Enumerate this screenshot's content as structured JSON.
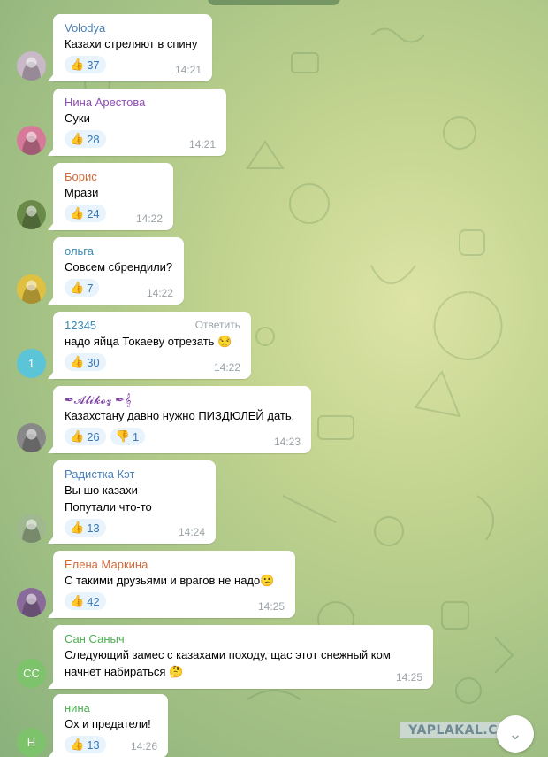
{
  "colors": {
    "reaction_bg": "#e8f3fb",
    "reaction_text": "#3a78b5",
    "time": "#9aa3a7"
  },
  "messages": [
    {
      "name": "Volodya",
      "name_color": "#4a7fb5",
      "text": [
        "Казахи стреляют в спину"
      ],
      "reactions": [
        {
          "emoji": "👍",
          "count": "37"
        }
      ],
      "time": "14:21",
      "avatar": {
        "type": "photo",
        "bg": "#c9b8c8"
      }
    },
    {
      "name": "Нина Арестова",
      "name_color": "#8e4bb5",
      "text": [
        "Суки"
      ],
      "reactions": [
        {
          "emoji": "👍",
          "count": "28"
        }
      ],
      "time": "14:21",
      "avatar": {
        "type": "photo",
        "bg": "#d77a9a"
      }
    },
    {
      "name": "Борис",
      "name_color": "#d16a3a",
      "text": [
        "Мрази"
      ],
      "reactions": [
        {
          "emoji": "👍",
          "count": "24"
        }
      ],
      "time": "14:22",
      "avatar": {
        "type": "photo",
        "bg": "#6a8a4a"
      }
    },
    {
      "name": "ольга",
      "name_color": "#3a8ab5",
      "text": [
        "Совсем сбрендили?"
      ],
      "reactions": [
        {
          "emoji": "👍",
          "count": "7"
        }
      ],
      "time": "14:22",
      "avatar": {
        "type": "photo",
        "bg": "#e0c040"
      }
    },
    {
      "name": "12345",
      "name_color": "#3a8ab5",
      "reply": "Ответить",
      "text": [
        "надо яйца Токаеву отрезать 😒"
      ],
      "reactions": [
        {
          "emoji": "👍",
          "count": "30"
        }
      ],
      "time": "14:22",
      "avatar": {
        "type": "letter",
        "letter": "1",
        "bg": "#5bc4d6"
      }
    },
    {
      "name": "✒𝓐𝓵𝓲𝓴𝓸𝔃 ✒𝄞",
      "name_color": "#7a3fa0",
      "text": [
        "Казахстану давно нужно ПИЗДЮЛЕЙ дать."
      ],
      "reactions": [
        {
          "emoji": "👍",
          "count": "26"
        },
        {
          "emoji": "👎",
          "count": "1"
        }
      ],
      "time": "14:23",
      "avatar": {
        "type": "photo",
        "bg": "#888"
      }
    },
    {
      "name": "Радистка Кэт",
      "name_color": "#4a7fb5",
      "text": [
        "Вы шо казахи",
        "Попутали что-то"
      ],
      "reactions": [
        {
          "emoji": "👍",
          "count": "13"
        }
      ],
      "time": "14:24",
      "avatar": {
        "type": "photo",
        "bg": "#a0b890"
      }
    },
    {
      "name": "Елена Маркина",
      "name_color": "#d16a3a",
      "text": [
        "С такими друзьями и врагов не надо😕"
      ],
      "reactions": [
        {
          "emoji": "👍",
          "count": "42"
        }
      ],
      "time": "14:25",
      "avatar": {
        "type": "photo",
        "bg": "#8a6a9a"
      }
    },
    {
      "name": "Сан Саныч",
      "name_color": "#4caf50",
      "text": [
        "Следующий замес с казахами походу, щас этот снежный ком",
        "начнёт набираться 🤔"
      ],
      "reactions": [],
      "time": "14:25",
      "avatar": {
        "type": "letter",
        "letter": "СС",
        "bg": "#7dc36b"
      }
    },
    {
      "name": "нина",
      "name_color": "#4caf50",
      "text": [
        "Ох и предатели!"
      ],
      "reactions": [
        {
          "emoji": "👍",
          "count": "13"
        }
      ],
      "time": "14:26",
      "avatar": {
        "type": "letter",
        "letter": "Н",
        "bg": "#7dc36b"
      }
    }
  ],
  "scroll_down_icon": "chevron-down-icon",
  "watermark": "YAPLAKAL.COM"
}
